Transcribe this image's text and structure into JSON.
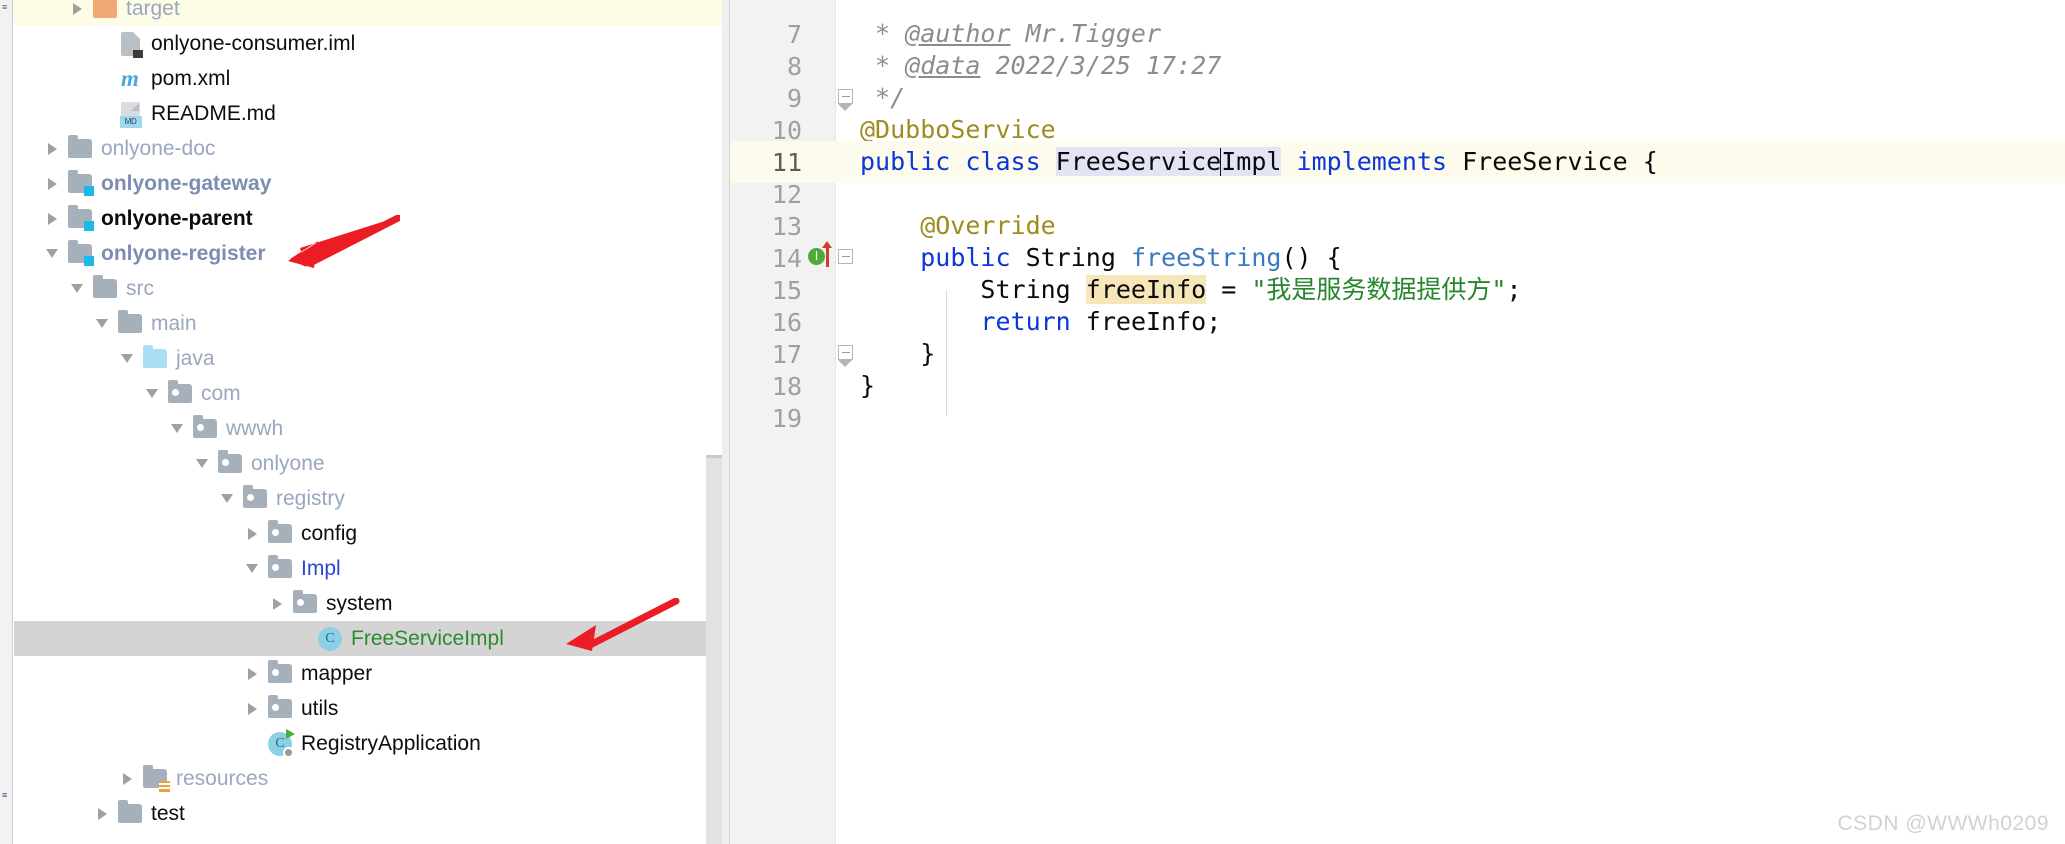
{
  "colors": {
    "accent_blue": "#1bb8e8",
    "selection_gray": "#d4d4d4",
    "hover_yellow": "#fdfde7",
    "caret_line": "#fdfbeb",
    "vcs_added_green": "#2d8a2d",
    "vcs_modified_blue": "#2b44d6",
    "annotation_red": "#ec1c24",
    "keyword_blue": "#0c36d8",
    "annotation_olive": "#9e8c1e",
    "string_green": "#27862c",
    "comment_gray": "#8c8c8c",
    "identifier_highlight": "#e4e4f7",
    "variable_highlight": "#f6e6ba"
  },
  "stripe": {
    "top_label": "≡",
    "bottom_label": "≡"
  },
  "project_tree": {
    "scrollbar": {
      "name": "vertical-scrollbar"
    },
    "rows": [
      {
        "id": "target",
        "label": "target",
        "indent": 2,
        "twisty": "right",
        "icon": "folder-orange",
        "style": "muted",
        "state": "hovered"
      },
      {
        "id": "onlyone-consumer-iml",
        "label": "onlyone-consumer.iml",
        "indent": 3,
        "twisty": "none",
        "icon": "file-iml",
        "style": "normal",
        "state": "none"
      },
      {
        "id": "pom-xml",
        "label": "pom.xml",
        "indent": 3,
        "twisty": "none",
        "icon": "maven",
        "style": "normal",
        "state": "none"
      },
      {
        "id": "readme-md",
        "label": "README.md",
        "indent": 3,
        "twisty": "none",
        "icon": "file-md",
        "style": "normal",
        "state": "none"
      },
      {
        "id": "onlyone-doc",
        "label": "onlyone-doc",
        "indent": 1,
        "twisty": "right",
        "icon": "folder",
        "style": "muted",
        "state": "none"
      },
      {
        "id": "onlyone-gateway",
        "label": "onlyone-gateway",
        "indent": 1,
        "twisty": "right",
        "icon": "folder-module",
        "style": "modblue",
        "state": "none"
      },
      {
        "id": "onlyone-parent",
        "label": "onlyone-parent",
        "indent": 1,
        "twisty": "right",
        "icon": "folder-module",
        "style": "bold",
        "state": "none"
      },
      {
        "id": "onlyone-register",
        "label": "onlyone-register",
        "indent": 1,
        "twisty": "down",
        "icon": "folder-module",
        "style": "modblue",
        "state": "none"
      },
      {
        "id": "src",
        "label": "src",
        "indent": 2,
        "twisty": "down",
        "icon": "folder",
        "style": "muted",
        "state": "none"
      },
      {
        "id": "main",
        "label": "main",
        "indent": 3,
        "twisty": "down",
        "icon": "folder",
        "style": "muted",
        "state": "none"
      },
      {
        "id": "java",
        "label": "java",
        "indent": 4,
        "twisty": "down",
        "icon": "folder-source",
        "style": "muted",
        "state": "none"
      },
      {
        "id": "com",
        "label": "com",
        "indent": 5,
        "twisty": "down",
        "icon": "folder-package",
        "style": "muted",
        "state": "none"
      },
      {
        "id": "wwwh",
        "label": "wwwh",
        "indent": 6,
        "twisty": "down",
        "icon": "folder-package",
        "style": "muted",
        "state": "none"
      },
      {
        "id": "onlyone",
        "label": "onlyone",
        "indent": 7,
        "twisty": "down",
        "icon": "folder-package",
        "style": "muted",
        "state": "none"
      },
      {
        "id": "registry",
        "label": "registry",
        "indent": 8,
        "twisty": "down",
        "icon": "folder-package",
        "style": "muted",
        "state": "none"
      },
      {
        "id": "config",
        "label": "config",
        "indent": 9,
        "twisty": "right",
        "icon": "folder-package",
        "style": "normal",
        "state": "none"
      },
      {
        "id": "impl",
        "label": "Impl",
        "indent": 9,
        "twisty": "down",
        "icon": "folder-package",
        "style": "vcsblue",
        "state": "none"
      },
      {
        "id": "system",
        "label": "system",
        "indent": 10,
        "twisty": "right",
        "icon": "folder-package",
        "style": "normal",
        "state": "none"
      },
      {
        "id": "freeserviceimpl",
        "label": "FreeServiceImpl",
        "indent": 11,
        "twisty": "none",
        "icon": "class",
        "style": "vcsgreen",
        "state": "selected"
      },
      {
        "id": "mapper",
        "label": "mapper",
        "indent": 9,
        "twisty": "right",
        "icon": "folder-package",
        "style": "normal",
        "state": "none"
      },
      {
        "id": "utils",
        "label": "utils",
        "indent": 9,
        "twisty": "right",
        "icon": "folder-package",
        "style": "normal",
        "state": "none"
      },
      {
        "id": "registryapplication",
        "label": "RegistryApplication",
        "indent": 9,
        "twisty": "none",
        "icon": "class-runnable",
        "style": "normal",
        "state": "none"
      },
      {
        "id": "resources",
        "label": "resources",
        "indent": 4,
        "twisty": "right",
        "icon": "folder-resources",
        "style": "muted",
        "state": "none"
      },
      {
        "id": "test",
        "label": "test",
        "indent": 3,
        "twisty": "right",
        "icon": "folder",
        "style": "normal",
        "state": "none"
      }
    ]
  },
  "editor": {
    "lines": [
      {
        "no": "7",
        "caretline": false,
        "gutter_mark": "none",
        "fold": "none",
        "tokens": [
          {
            "text": " * ",
            "cls": "t-comment"
          },
          {
            "text": "@author",
            "cls": "t-tag"
          },
          {
            "text": " Mr.Tigger",
            "cls": "t-comment"
          }
        ]
      },
      {
        "no": "8",
        "caretline": false,
        "gutter_mark": "none",
        "fold": "none",
        "tokens": [
          {
            "text": " * ",
            "cls": "t-comment"
          },
          {
            "text": "@data",
            "cls": "t-tag"
          },
          {
            "text": " 2022/3/25 17:27",
            "cls": "t-comment"
          }
        ]
      },
      {
        "no": "9",
        "caretline": false,
        "gutter_mark": "none",
        "fold": "end",
        "tokens": [
          {
            "text": " */",
            "cls": "t-comment"
          }
        ]
      },
      {
        "no": "10",
        "caretline": false,
        "gutter_mark": "none",
        "fold": "none",
        "tokens": [
          {
            "text": "@DubboService",
            "cls": "t-anno"
          }
        ]
      },
      {
        "no": "11",
        "caretline": true,
        "gutter_mark": "none",
        "fold": "none",
        "tokens": [
          {
            "text": "public class ",
            "cls": "t-kw"
          },
          {
            "text": "FreeService",
            "cls": "t-plain t-hl-id"
          },
          {
            "text": "CARET",
            "cls": "caret"
          },
          {
            "text": "Impl",
            "cls": "t-plain t-hl-id"
          },
          {
            "text": " ",
            "cls": "t-plain"
          },
          {
            "text": "implements",
            "cls": "t-kw"
          },
          {
            "text": " FreeService {",
            "cls": "t-plain"
          }
        ]
      },
      {
        "no": "12",
        "caretline": false,
        "gutter_mark": "none",
        "fold": "none",
        "tokens": []
      },
      {
        "no": "13",
        "caretline": false,
        "gutter_mark": "none",
        "fold": "none",
        "tokens": [
          {
            "text": "    @Override",
            "cls": "t-anno"
          }
        ]
      },
      {
        "no": "14",
        "caretline": false,
        "gutter_mark": "implements",
        "fold": "start",
        "tokens": [
          {
            "text": "    ",
            "cls": "t-plain"
          },
          {
            "text": "public ",
            "cls": "t-kw"
          },
          {
            "text": "String ",
            "cls": "t-plain"
          },
          {
            "text": "freeString",
            "cls": "t-method"
          },
          {
            "text": "() {",
            "cls": "t-plain"
          }
        ]
      },
      {
        "no": "15",
        "caretline": false,
        "gutter_mark": "none",
        "fold": "none",
        "tokens": [
          {
            "text": "        String ",
            "cls": "t-plain"
          },
          {
            "text": "freeInfo",
            "cls": "t-plain t-hl-var"
          },
          {
            "text": " = ",
            "cls": "t-plain"
          },
          {
            "text": "\"我是服务数据提供方\"",
            "cls": "t-string"
          },
          {
            "text": ";",
            "cls": "t-plain"
          }
        ]
      },
      {
        "no": "16",
        "caretline": false,
        "gutter_mark": "none",
        "fold": "none",
        "tokens": [
          {
            "text": "        ",
            "cls": "t-plain"
          },
          {
            "text": "return",
            "cls": "t-kw"
          },
          {
            "text": " freeInfo;",
            "cls": "t-plain"
          }
        ]
      },
      {
        "no": "17",
        "caretline": false,
        "gutter_mark": "none",
        "fold": "end",
        "tokens": [
          {
            "text": "    }",
            "cls": "t-plain"
          }
        ]
      },
      {
        "no": "18",
        "caretline": false,
        "gutter_mark": "none",
        "fold": "none",
        "tokens": [
          {
            "text": "}",
            "cls": "t-plain"
          }
        ]
      },
      {
        "no": "19",
        "caretline": false,
        "gutter_mark": "none",
        "fold": "none",
        "tokens": []
      }
    ]
  },
  "annotations": [
    {
      "id": "arrow-to-onlyone-register",
      "target": "onlyone-register"
    },
    {
      "id": "arrow-to-freeserviceimpl",
      "target": "FreeServiceImpl"
    }
  ],
  "watermark": {
    "text": "CSDN @WWWh0209"
  }
}
